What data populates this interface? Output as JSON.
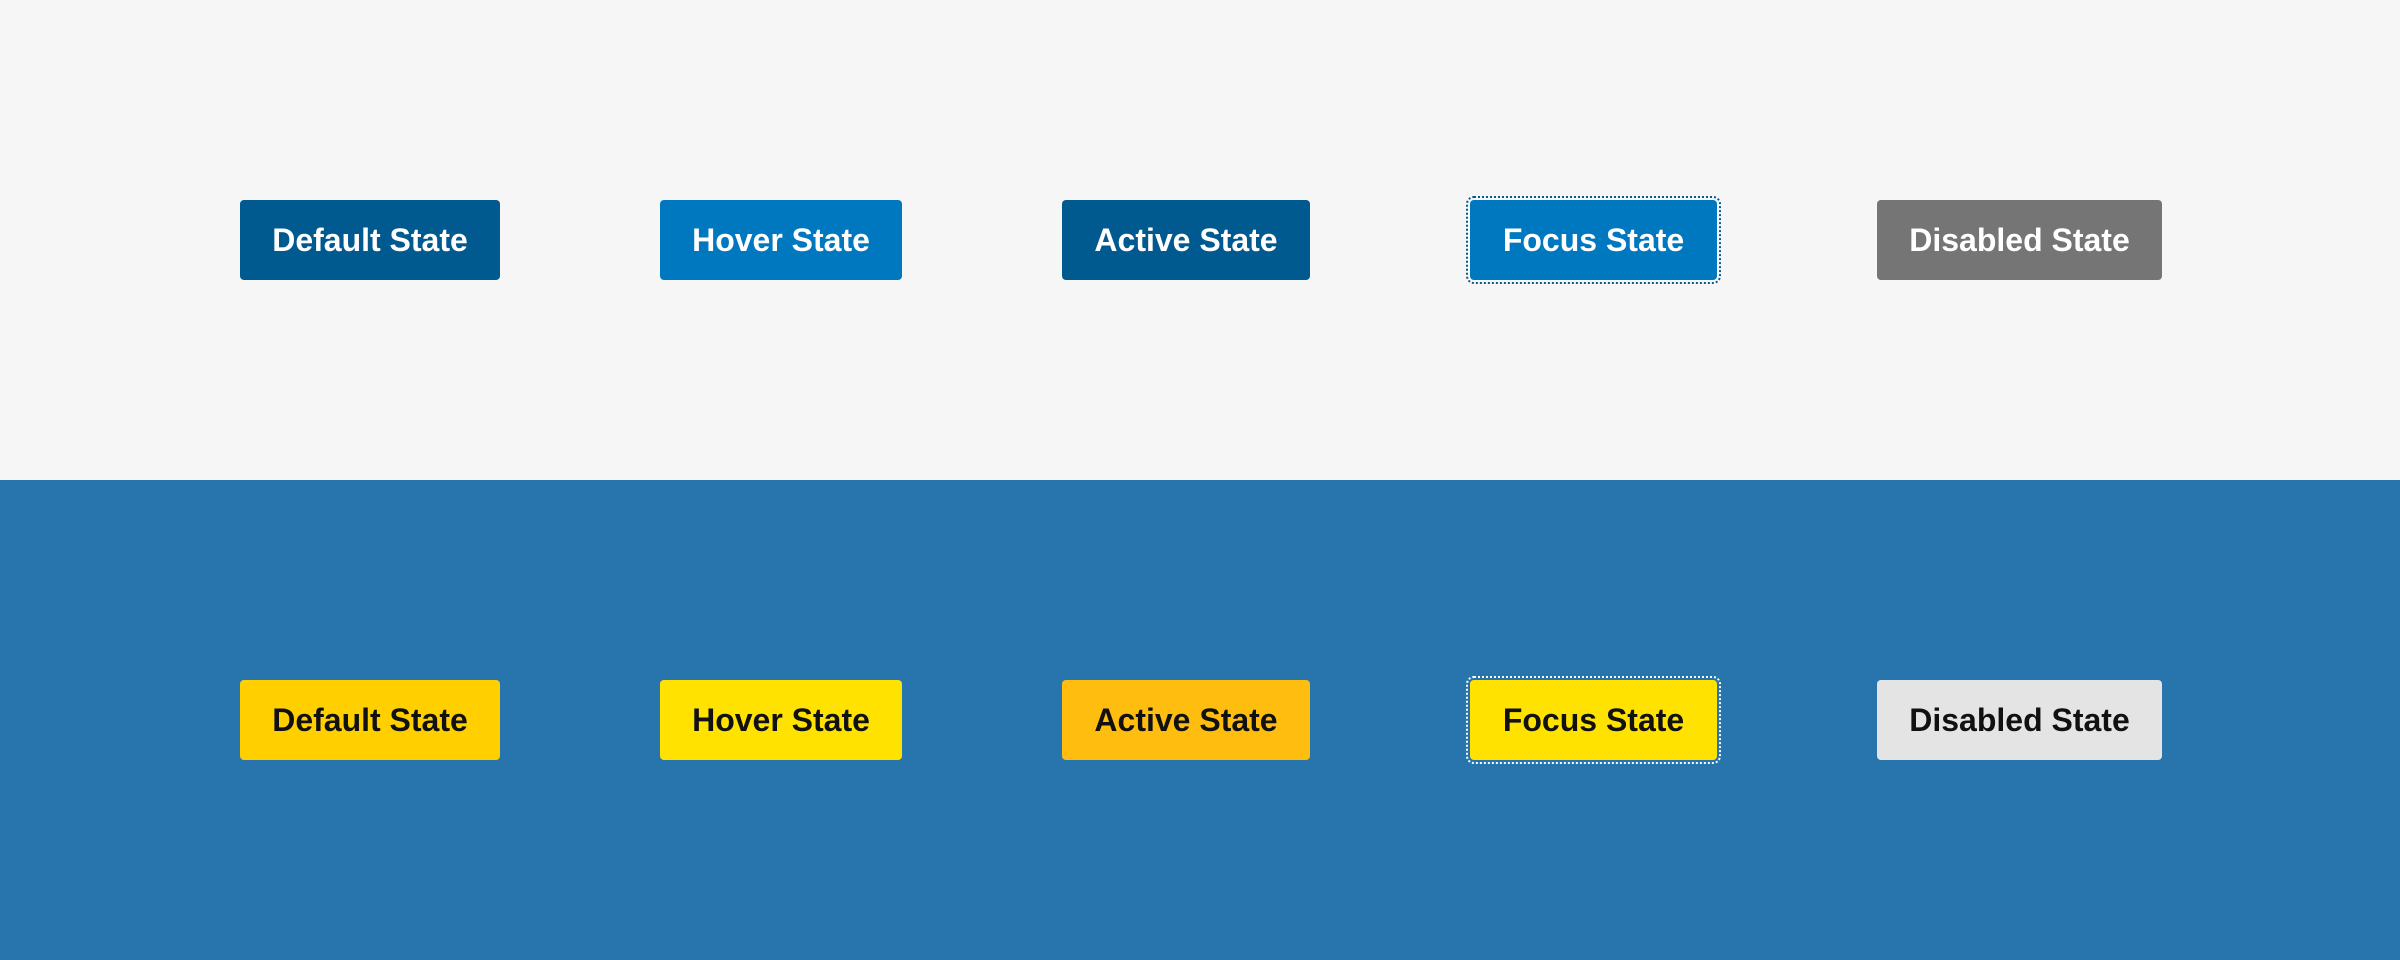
{
  "light_row": {
    "buttons": [
      {
        "label": "Default State",
        "state": "default",
        "color": "#005a8f"
      },
      {
        "label": "Hover State",
        "state": "hover",
        "color": "#0078c0"
      },
      {
        "label": "Active State",
        "state": "active",
        "color": "#005a8f"
      },
      {
        "label": "Focus State",
        "state": "focus",
        "color": "#0078c0"
      },
      {
        "label": "Disabled State",
        "state": "disabled",
        "color": "#757575"
      }
    ],
    "background": "#f7f6f7",
    "text_color": "#ffffff"
  },
  "dark_row": {
    "buttons": [
      {
        "label": "Default State",
        "state": "default",
        "color": "#ffcf00"
      },
      {
        "label": "Hover State",
        "state": "hover",
        "color": "#ffe200"
      },
      {
        "label": "Active State",
        "state": "active",
        "color": "#ffbe0f"
      },
      {
        "label": "Focus State",
        "state": "focus",
        "color": "#ffe200"
      },
      {
        "label": "Disabled State",
        "state": "disabled",
        "color": "#e4e4e4"
      }
    ],
    "background": "#2874ad",
    "text_color": "#111111"
  }
}
